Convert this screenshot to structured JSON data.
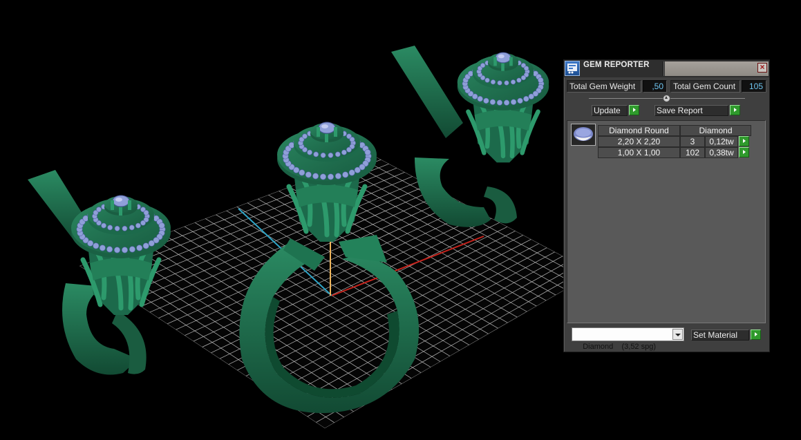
{
  "panel": {
    "title": "GEM REPORTER",
    "close_label": "×",
    "total_weight_label": "Total Gem Weight",
    "total_weight_value": ",50",
    "total_count_label": "Total Gem Count",
    "total_count_value": "105",
    "update_label": "Update",
    "save_label": "Save Report",
    "table": {
      "headers": [
        "Diamond Round",
        "Diamond"
      ],
      "rows": [
        {
          "size": "2,20 X 2,20",
          "count": "3",
          "weight": "0,12tw"
        },
        {
          "size": "1,00 X 1,00",
          "count": "102",
          "weight": "0,38tw"
        }
      ]
    },
    "material_selected": "Diamond    (3,52 spg)",
    "set_material_label": "Set Material"
  },
  "colors": {
    "metal": "#1e6b4c",
    "gem": "#8f9fd8",
    "grid": "#f0f0f0",
    "axis_x": "#c8241d",
    "axis_y": "#2fa6c8",
    "axis_z": "#f0b65c",
    "go_button": "#2f9a2c"
  }
}
